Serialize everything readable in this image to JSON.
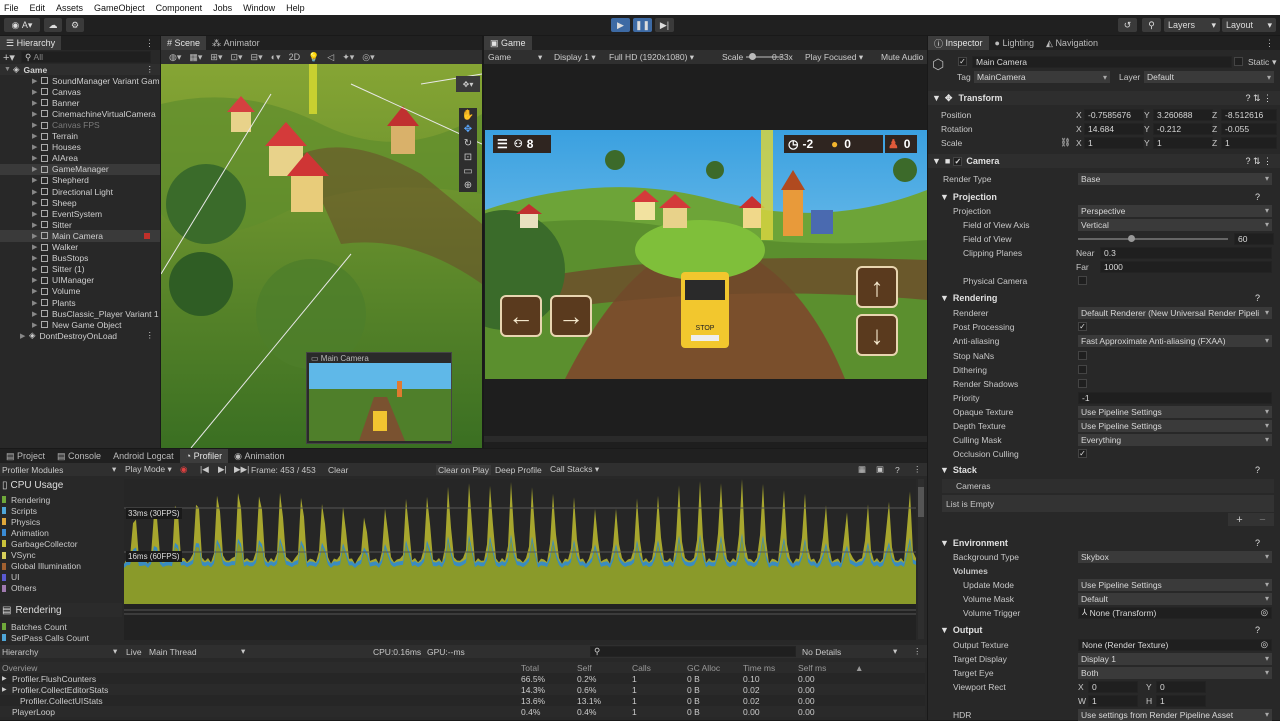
{
  "menu": [
    "File",
    "Edit",
    "Assets",
    "GameObject",
    "Component",
    "Jobs",
    "Window",
    "Help"
  ],
  "toolbar": {
    "account": "A",
    "layers": "Layers",
    "layout": "Layout"
  },
  "hierarchy": {
    "tab": "Hierarchy",
    "search": "All",
    "root": "Game",
    "items": [
      {
        "label": "SoundManager Variant Gam",
        "dim": false,
        "sel": false
      },
      {
        "label": "Canvas",
        "dim": false,
        "sel": false
      },
      {
        "label": "Banner",
        "dim": false,
        "sel": false
      },
      {
        "label": "CinemachineVirtualCamera",
        "dim": false,
        "sel": false
      },
      {
        "label": "Canvas FPS",
        "dim": true,
        "sel": false
      },
      {
        "label": "Terrain",
        "dim": false,
        "sel": false
      },
      {
        "label": "Houses",
        "dim": false,
        "sel": false
      },
      {
        "label": "AIArea",
        "dim": false,
        "sel": false
      },
      {
        "label": "GameManager",
        "dim": false,
        "sel": true
      },
      {
        "label": "Shepherd",
        "dim": false,
        "sel": false
      },
      {
        "label": "Directional Light",
        "dim": false,
        "sel": false
      },
      {
        "label": "Sheep",
        "dim": false,
        "sel": false
      },
      {
        "label": "EventSystem",
        "dim": false,
        "sel": false
      },
      {
        "label": "Sitter",
        "dim": false,
        "sel": false
      },
      {
        "label": "Main Camera",
        "dim": false,
        "sel": true
      },
      {
        "label": "Walker",
        "dim": false,
        "sel": false
      },
      {
        "label": "BusStops",
        "dim": false,
        "sel": false
      },
      {
        "label": "Sitter (1)",
        "dim": false,
        "sel": false
      },
      {
        "label": "UIManager",
        "dim": false,
        "sel": false
      },
      {
        "label": "Volume",
        "dim": false,
        "sel": false
      },
      {
        "label": "Plants",
        "dim": false,
        "sel": false
      },
      {
        "label": "BusClassic_Player Variant 1",
        "dim": false,
        "sel": false
      },
      {
        "label": "New Game Object",
        "dim": false,
        "sel": false
      }
    ],
    "ddol": "DontDestroyOnLoad"
  },
  "scene": {
    "tabs": [
      "Scene",
      "Animator"
    ],
    "mode2d": "2D",
    "preview_title": "Main Camera"
  },
  "game": {
    "tab": "Game",
    "view": "Game",
    "display": "Display 1",
    "resolution": "Full HD (1920x1080)",
    "scale_label": "Scale",
    "scale_value": "0.33x",
    "play_focused": "Play Focused",
    "mute": "Mute Audio",
    "hud_count": "8",
    "hud_time": "-2",
    "hud_coins": "0",
    "hud_passengers": "0",
    "bus_sign": "STOP",
    "arrows": {
      "left": "←",
      "right": "→",
      "up": "↑",
      "down": "↓"
    }
  },
  "bottom_tabs": [
    "Project",
    "Console",
    "Android Logcat",
    "Profiler",
    "Animation"
  ],
  "profiler": {
    "modules": "Profiler Modules",
    "playmode": "Play Mode",
    "frame": "Frame: 453 / 453",
    "clear": "Clear",
    "clear_on_play": "Clear on Play",
    "deep": "Deep Profile",
    "callstacks": "Call Stacks",
    "cpu_title": "CPU Usage",
    "legend": [
      {
        "label": "Rendering",
        "color": "#6fa83a"
      },
      {
        "label": "Scripts",
        "color": "#4fa6d8"
      },
      {
        "label": "Physics",
        "color": "#e0a73a"
      },
      {
        "label": "Animation",
        "color": "#3a8cd6"
      },
      {
        "label": "GarbageCollector",
        "color": "#c9c23a"
      },
      {
        "label": "VSync",
        "color": "#d7cf5a"
      },
      {
        "label": "Global Illumination",
        "color": "#a06030"
      },
      {
        "label": "UI",
        "color": "#5a5ad0"
      },
      {
        "label": "Others",
        "color": "#a07ab0"
      }
    ],
    "fps33": "33ms (30FPS)",
    "fps16": "16ms (60FPS)",
    "rendering_title": "Rendering",
    "batches": "Batches Count",
    "setpass": "SetPass Calls Count",
    "hier_view": "Hierarchy",
    "live": "Live",
    "thread": "Main Thread",
    "cpu": "CPU:0.16ms",
    "gpu": "GPU:--ms",
    "details": "No Details",
    "columns": [
      "Overview",
      "Total",
      "Self",
      "Calls",
      "GC Alloc",
      "Time ms",
      "Self ms"
    ],
    "rows": [
      {
        "name": "Profiler.FlushCounters",
        "total": "66.5%",
        "self": "0.2%",
        "calls": "1",
        "gc": "0 B",
        "time": "0.10",
        "selfms": "0.00"
      },
      {
        "name": "Profiler.CollectEditorStats",
        "total": "14.3%",
        "self": "0.6%",
        "calls": "1",
        "gc": "0 B",
        "time": "0.02",
        "selfms": "0.00"
      },
      {
        "name": "Profiler.CollectUIStats",
        "total": "13.6%",
        "self": "13.1%",
        "calls": "1",
        "gc": "0 B",
        "time": "0.02",
        "selfms": "0.00"
      },
      {
        "name": "PlayerLoop",
        "total": "0.4%",
        "self": "0.4%",
        "calls": "1",
        "gc": "0 B",
        "time": "0.00",
        "selfms": "0.00"
      }
    ]
  },
  "inspector": {
    "tabs": [
      "Inspector",
      "Lighting",
      "Navigation"
    ],
    "object_name": "Main Camera",
    "static": "Static",
    "tag_label": "Tag",
    "tag": "MainCamera",
    "layer_label": "Layer",
    "layer": "Default",
    "transform": {
      "title": "Transform",
      "position": {
        "label": "Position",
        "x": "-0.7585676",
        "y": "3.260688",
        "z": "-8.512616"
      },
      "rotation": {
        "label": "Rotation",
        "x": "14.684",
        "y": "-0.212",
        "z": "-0.055"
      },
      "scale": {
        "label": "Scale",
        "x": "1",
        "y": "1",
        "z": "1"
      }
    },
    "camera": {
      "title": "Camera",
      "render_type_label": "Render Type",
      "render_type": "Base"
    },
    "projection": {
      "title": "Projection",
      "projection_label": "Projection",
      "projection": "Perspective",
      "fov_axis_label": "Field of View Axis",
      "fov_axis": "Vertical",
      "fov_label": "Field of View",
      "fov": "60",
      "clip_label": "Clipping Planes",
      "near_label": "Near",
      "near": "0.3",
      "far_label": "Far",
      "far": "1000",
      "physical_label": "Physical Camera"
    },
    "rendering": {
      "title": "Rendering",
      "renderer_label": "Renderer",
      "renderer": "Default Renderer (New Universal Render Pipeli",
      "post_label": "Post Processing",
      "aa_label": "Anti-aliasing",
      "aa": "Fast Approximate Anti-aliasing (FXAA)",
      "nan_label": "Stop NaNs",
      "dither_label": "Dithering",
      "shadows_label": "Render Shadows",
      "priority_label": "Priority",
      "priority": "-1",
      "opaque_label": "Opaque Texture",
      "opaque": "Use Pipeline Settings",
      "depth_label": "Depth Texture",
      "depth": "Use Pipeline Settings",
      "culling_label": "Culling Mask",
      "culling": "Everything",
      "occlusion_label": "Occlusion Culling"
    },
    "stack": {
      "title": "Stack",
      "cameras": "Cameras",
      "empty": "List is Empty"
    },
    "environment": {
      "title": "Environment",
      "bg_label": "Background Type",
      "bg": "Skybox",
      "volumes": "Volumes",
      "update_label": "Update Mode",
      "update": "Use Pipeline Settings",
      "mask_label": "Volume Mask",
      "mask": "Default",
      "trigger_label": "Volume Trigger",
      "trigger": "None (Transform)"
    },
    "output": {
      "title": "Output",
      "tex_label": "Output Texture",
      "tex": "None (Render Texture)",
      "display_label": "Target Display",
      "display": "Display 1",
      "eye_label": "Target Eye",
      "eye": "Both",
      "vp_label": "Viewport Rect",
      "vx": "0",
      "vy": "0",
      "vw": "1",
      "vh": "1",
      "hdr_label": "HDR",
      "hdr": "Use settings from Render Pipeline Asset"
    }
  }
}
